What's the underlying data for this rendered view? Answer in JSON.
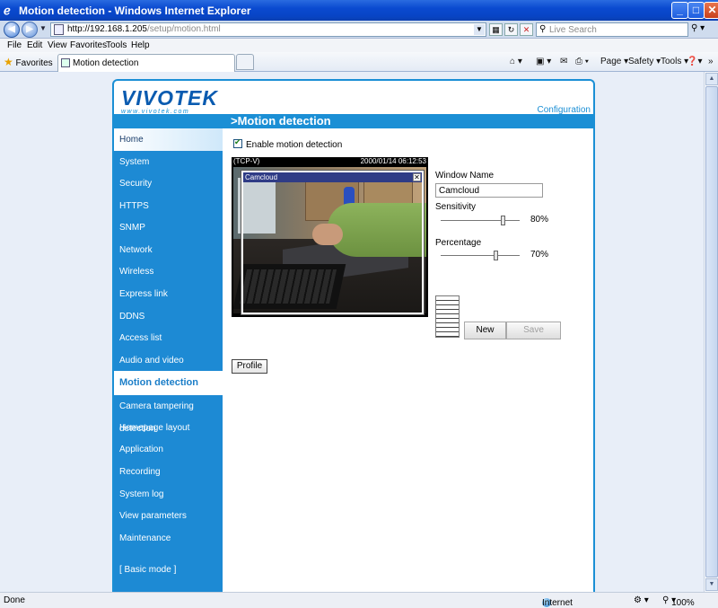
{
  "window": {
    "title": "Motion detection - Windows Internet Explorer"
  },
  "address": {
    "url_host": "http://192.168.1.205",
    "url_path": "/setup/motion.html",
    "search_placeholder": "Live Search"
  },
  "menu": [
    "File",
    "Edit",
    "View",
    "Favorites",
    "Tools",
    "Help"
  ],
  "favbar": {
    "favorites_label": "Favorites",
    "tab_title": "Motion detection"
  },
  "commands": {
    "page": "Page",
    "safety": "Safety",
    "tools": "Tools"
  },
  "status": {
    "left": "Done",
    "zone": "Internet",
    "zoom": "100%"
  },
  "page": {
    "brand": "VIVOTEK",
    "brand_sub": "www.vivotek.com",
    "config_link": "Configuration",
    "title": ">Motion detection",
    "sidebar": [
      "Home",
      "System",
      "Security",
      "HTTPS",
      "SNMP",
      "Network",
      "Wireless",
      "Express link",
      "DDNS",
      "Access list",
      "Audio and video",
      "Motion detection",
      "Camera tampering detection",
      "Homepage layout",
      "Application",
      "Recording",
      "System log",
      "View parameters",
      "Maintenance",
      "[ Basic mode ]"
    ],
    "enable_label": "Enable motion detection",
    "enable_checked": true,
    "video": {
      "stream": "(TCP-V)",
      "timestamp": "2000/01/14 06:12:53",
      "window_label": "Camcloud",
      "close_glyph": "✕"
    },
    "window_name_label": "Window Name",
    "window_name_value": "Camcloud",
    "sensitivity_label": "Sensitivity",
    "sensitivity_value": "80%",
    "sensitivity_level": 0.8,
    "percentage_label": "Percentage",
    "percentage_value": "70%",
    "percentage_level": 0.7,
    "new_button": "New",
    "save_button": "Save",
    "profile_button": "Profile"
  },
  "colors": {
    "accent": "#1b8fd5",
    "sidebar": "#1d8ad4",
    "active_text": "#1b7ec8"
  }
}
